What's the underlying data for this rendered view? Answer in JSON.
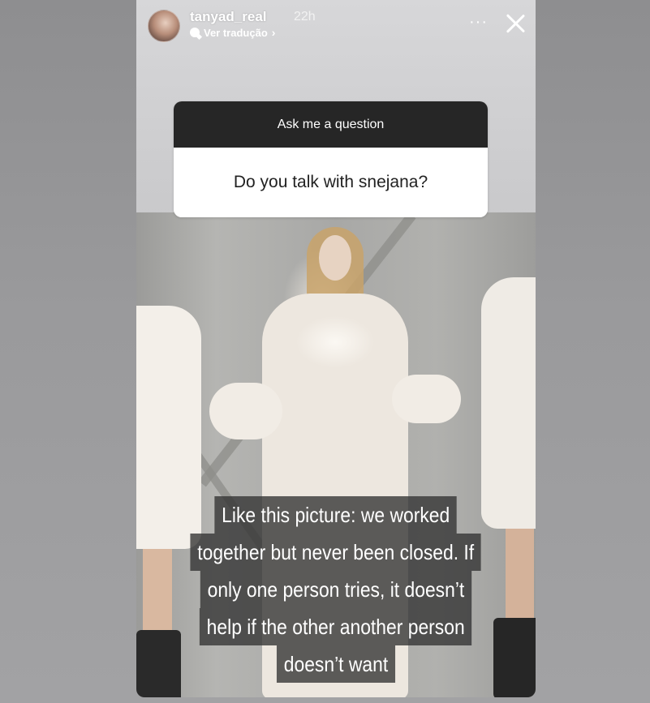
{
  "story": {
    "username": "tanyad_real",
    "time": "22h",
    "translate_label": "Ver tradução",
    "chevron": "›",
    "more": "···"
  },
  "question": {
    "header": "Ask me a question",
    "text": "Do you talk with snejana?"
  },
  "caption": {
    "lines": [
      "Like this picture: we worked",
      "together but never been closed. If",
      "only one person tries, it doesn’t",
      "help if the other another person",
      "doesn’t  want"
    ]
  },
  "icons": {
    "close": "close-icon",
    "more": "more-icon",
    "translate": "translate-icon",
    "avatar": "avatar"
  },
  "colors": {
    "background": "#9a9a9c",
    "question_header_bg": "#262626",
    "question_body_bg": "#ffffff",
    "caption_bg": "#323232"
  }
}
